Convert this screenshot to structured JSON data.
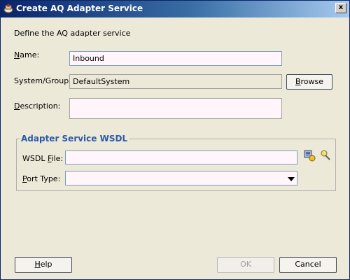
{
  "window": {
    "title": "Create AQ Adapter Service",
    "close_glyph": "x"
  },
  "intro_text": "Define the AQ adapter service",
  "form": {
    "name_label": "Name:",
    "name_value": "Inbound",
    "system_group_label": "System/Group:",
    "system_group_value": "DefaultSystem",
    "browse_label": "Browse",
    "description_label": "Description:",
    "description_value": ""
  },
  "wsdl_group": {
    "title": "Adapter Service WSDL",
    "wsdl_file_label": "WSDL File:",
    "wsdl_file_value": "",
    "port_type_label": "Port Type:",
    "port_type_value": "",
    "icons": [
      "wsdl-browse-icon",
      "wsdl-edit-icon"
    ]
  },
  "footer": {
    "help_label": "Help",
    "ok_label": "OK",
    "ok_enabled": false,
    "cancel_label": "Cancel"
  },
  "colors": {
    "titlebar_start": "#0a246a",
    "titlebar_end": "#a6caf0",
    "dialog_bg": "#ece9d8",
    "group_title": "#2b5aa8",
    "input_bg": "#fff5fa"
  }
}
